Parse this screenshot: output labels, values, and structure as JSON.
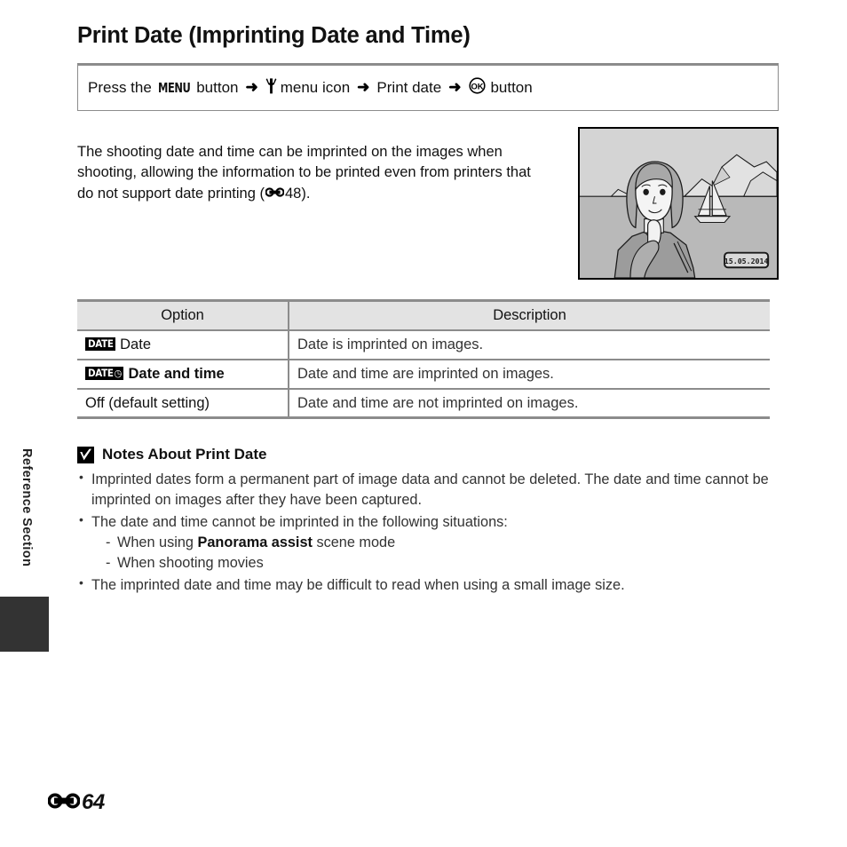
{
  "page": {
    "title": "Print Date (Imprinting Date and Time)",
    "running_head": "Reference Section",
    "folio_number": "64",
    "folio_icon": "reference-mark-icon"
  },
  "menu_path": {
    "prefix": "Press the",
    "menu_button_label": "MENU",
    "after_menu": "button",
    "arrow": "➜",
    "wrench_icon": "wrench-setup-menu-icon",
    "menu_icon_label": "menu icon",
    "item_label": "Print date",
    "ok_icon": "ok-button-icon",
    "ok_suffix": "button"
  },
  "intro": {
    "text_before_ref": "The shooting date and time can be imprinted on the images when shooting, allowing the information to be printed even from printers that do not support date printing (",
    "ref_icon": "reference-mark-icon",
    "ref_page": "48",
    "text_after_ref": ")."
  },
  "illustration": {
    "name": "sample-photo-with-date-imprint",
    "date_stamp": "15.05.2014",
    "scene_elements": [
      "sky",
      "mountains",
      "lake",
      "sailboat",
      "woman-portrait"
    ],
    "colors": {
      "sky": "#d6d6d6",
      "water": "#b8b8b8",
      "mountain": "#e0e0e0",
      "skin": "#f2f2f2",
      "hair": "#a8a8a8",
      "clothing": "#9a9a9a",
      "outline": "#1a1a1a"
    }
  },
  "options_table": {
    "headers": [
      "Option",
      "Description"
    ],
    "rows": [
      {
        "icon": "date-badge-icon",
        "badge_text": "DATE",
        "badge_clock": false,
        "label": "Date",
        "description": "Date is imprinted on images."
      },
      {
        "icon": "date-time-badge-icon",
        "badge_text": "DATE",
        "badge_clock": true,
        "label": "Date and time",
        "description": "Date and time are imprinted on images."
      },
      {
        "icon": null,
        "badge_text": null,
        "badge_clock": false,
        "label": "Off (default setting)",
        "description": "Date and time are not imprinted on images."
      }
    ]
  },
  "notes": {
    "icon": "caution-checkmark-icon",
    "heading": "Notes About Print Date",
    "items": [
      {
        "text": "Imprinted dates form a permanent part of image data and cannot be deleted. The date and time cannot be imprinted on images after they have been captured."
      },
      {
        "text": "The date and time cannot be imprinted in the following situations:",
        "sub_items": [
          {
            "before_bold": "When using ",
            "bold": "Panorama assist",
            "after_bold": " scene mode"
          },
          {
            "before_bold": "When shooting movies",
            "bold": "",
            "after_bold": ""
          }
        ]
      },
      {
        "text": "The imprinted date and time may be difficult to read when using a small image size."
      }
    ]
  },
  "colors": {
    "rule": "#8c8c8c",
    "table_header_bg": "#e3e3e3",
    "tab_black": "#333333",
    "text": "#1a1a1a"
  }
}
